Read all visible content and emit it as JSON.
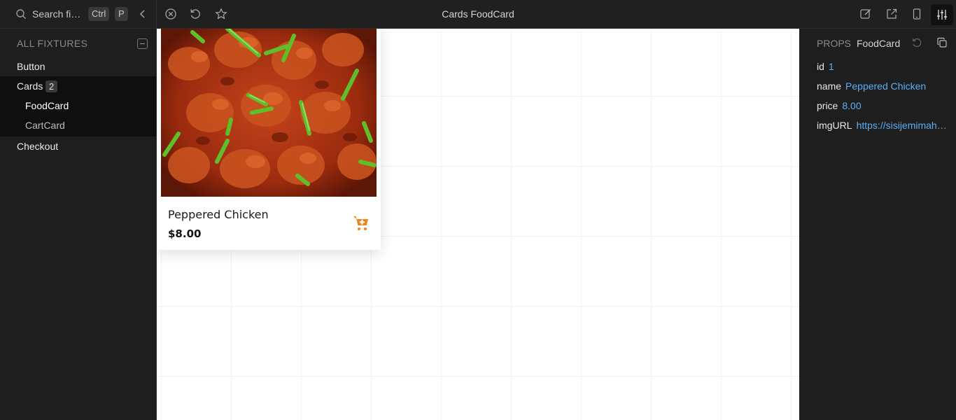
{
  "search": {
    "placeholder": "Search fi…",
    "shortcut_ctrl": "Ctrl",
    "shortcut_key": "P"
  },
  "window": {
    "title": "Cards FoodCard"
  },
  "sidebar": {
    "heading": "ALL FIXTURES",
    "items": [
      {
        "label": "Button"
      },
      {
        "label": "Cards",
        "count": "2"
      },
      {
        "label": "FoodCard"
      },
      {
        "label": "CartCard"
      },
      {
        "label": "Checkout"
      }
    ]
  },
  "card": {
    "name": "Peppered Chicken",
    "price": "$8.00",
    "accent_color": "#e8871e"
  },
  "props": {
    "heading": "PROPS",
    "component": "FoodCard",
    "fields": [
      {
        "key": "id",
        "value": "1"
      },
      {
        "key": "name",
        "value": "Peppered Chicken"
      },
      {
        "key": "price",
        "value": "8.00"
      },
      {
        "key": "imgURL",
        "value": "https://sisijemimah…"
      }
    ]
  },
  "colors": {
    "panel_bg": "#1e1e1e",
    "value_blue": "#5ab0f5",
    "canvas_bg": "#ffffff"
  }
}
